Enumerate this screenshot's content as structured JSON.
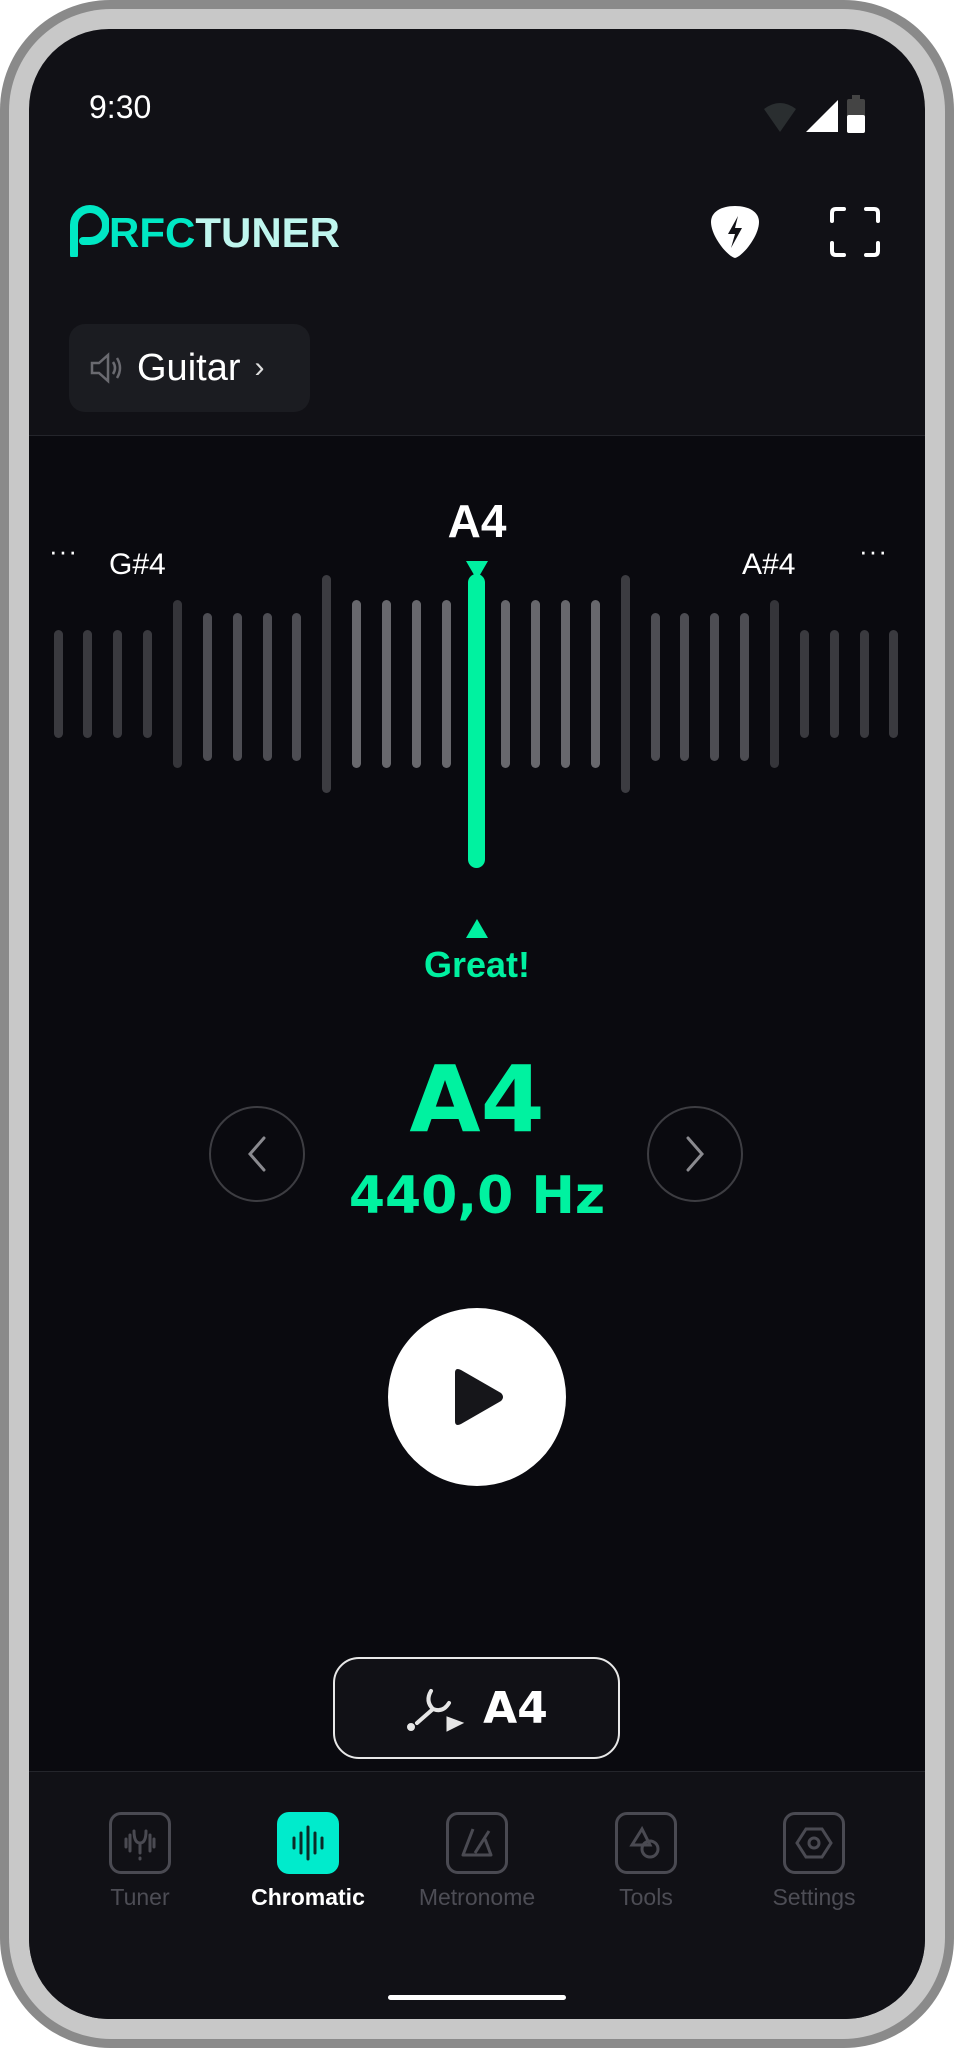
{
  "status_bar": {
    "time": "9:30"
  },
  "header": {
    "logo": {
      "prefix": "RFC",
      "suffix": "TUNER"
    },
    "icons": [
      "guitar-pick-bolt-icon",
      "fullscreen-icon"
    ]
  },
  "instrument_chip": {
    "label": "Guitar",
    "chevron": "›",
    "icon": "speaker-icon"
  },
  "tuner": {
    "target_note": "A4",
    "prev_note": "G#4",
    "next_note": "A#4",
    "more_left": "···",
    "more_right": "···",
    "status": "Great!",
    "accent_color": "#00f2a0"
  },
  "note_display": {
    "note": "A4",
    "frequency": "440,0 Hz"
  },
  "reference_button": {
    "label": "A4",
    "icon": "tuning-fork-play-icon"
  },
  "nav": {
    "items": [
      {
        "label": "Tuner",
        "icon": "tuning-fork-icon",
        "active": false
      },
      {
        "label": "Chromatic",
        "icon": "waveform-icon",
        "active": true
      },
      {
        "label": "Metronome",
        "icon": "metronome-icon",
        "active": false
      },
      {
        "label": "Tools",
        "icon": "shapes-icon",
        "active": false
      },
      {
        "label": "Settings",
        "icon": "hexagon-nut-icon",
        "active": false
      }
    ],
    "active_color": "#00ebcc"
  }
}
